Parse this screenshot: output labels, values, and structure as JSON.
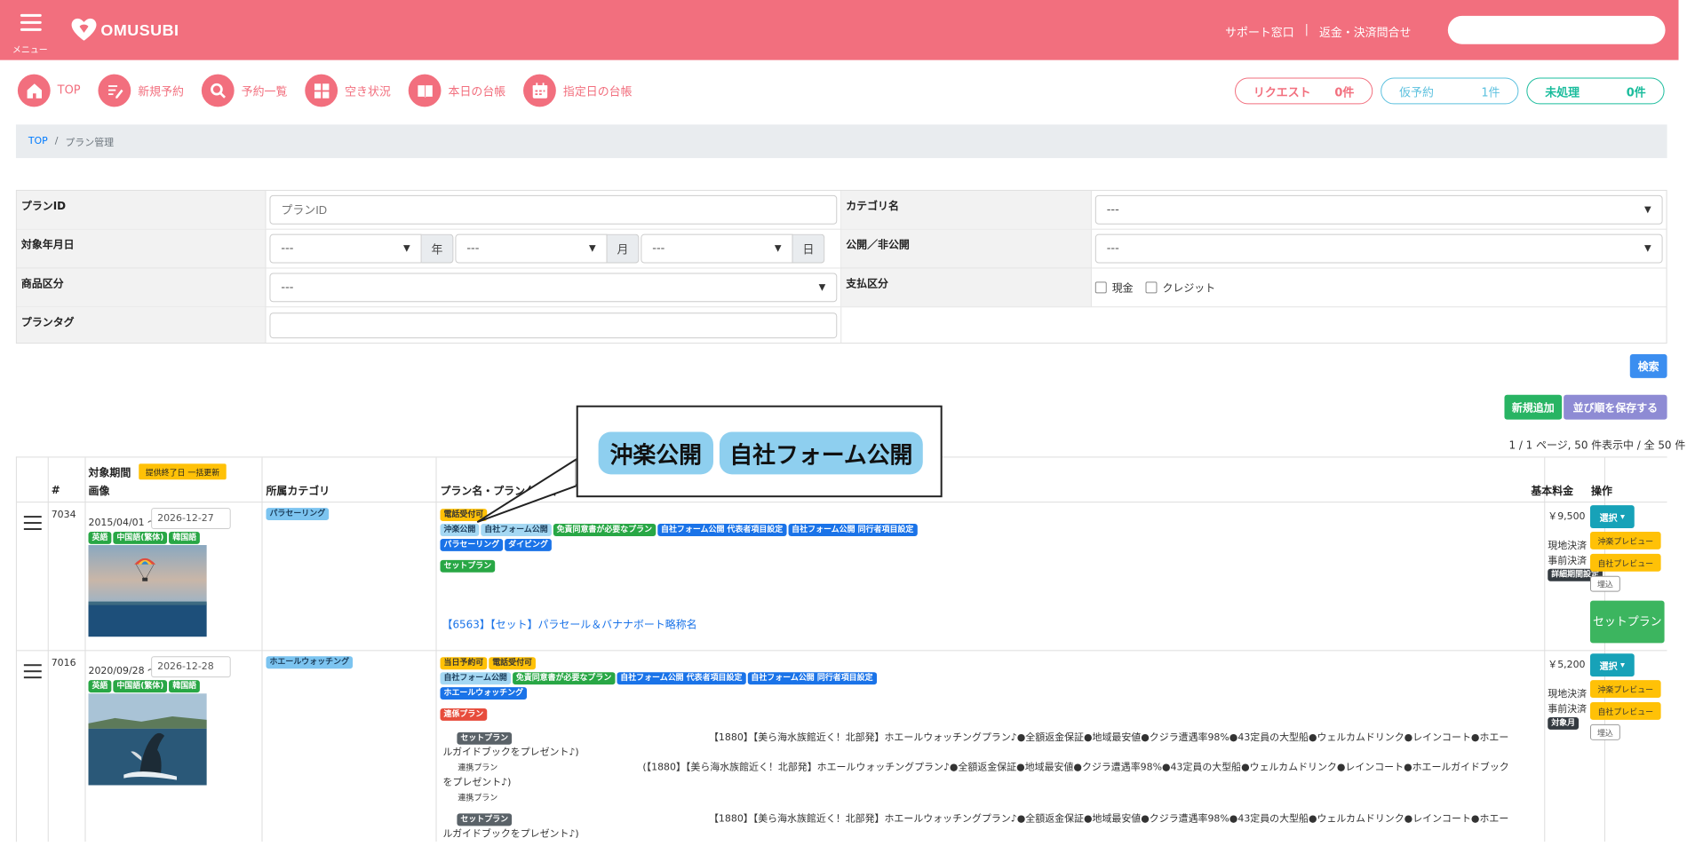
{
  "header": {
    "menu_label": "メニュー",
    "logo_text": "OMUSUBI",
    "support_link": "サポート窓口",
    "separator": "|",
    "refund_link": "返金・決済問合せ",
    "search_placeholder": ""
  },
  "quicknav": [
    {
      "label": "TOP",
      "icon": "home-icon"
    },
    {
      "label": "新規予約",
      "icon": "edit-icon"
    },
    {
      "label": "予約一覧",
      "icon": "search-icon"
    },
    {
      "label": "空き状況",
      "icon": "grid-icon"
    },
    {
      "label": "本日の台帳",
      "icon": "book-icon"
    },
    {
      "label": "指定日の台帳",
      "icon": "calendar-icon"
    }
  ],
  "status": {
    "request_label": "リクエスト",
    "request_count": "0件",
    "temp_label": "仮予約",
    "temp_count": "1件",
    "unprocessed_label": "未処理",
    "unprocessed_count": "0件"
  },
  "breadcrumb": {
    "top": "TOP",
    "sep": "/",
    "current": "プラン管理"
  },
  "form": {
    "plan_id_label": "プランID",
    "plan_id_placeholder": "プランID",
    "category_label": "カテゴリ名",
    "category_value": "---",
    "date_label": "対象年月日",
    "year_value": "---",
    "year_unit": "年",
    "month_value": "---",
    "month_unit": "月",
    "day_value": "---",
    "day_unit": "日",
    "public_label": "公開／非公開",
    "public_value": "---",
    "product_label": "商品区分",
    "product_value": "---",
    "payment_label": "支払区分",
    "cash_label": "現金",
    "credit_label": "クレジット",
    "tag_label": "プランタグ"
  },
  "buttons": {
    "search": "検索",
    "new": "新規追加",
    "save_order": "並び順を保存する"
  },
  "page_info": "1 / 1 ページ, 50 件表示中 / 全 50 件",
  "table": {
    "headers": {
      "num": "#",
      "period": "対象期間",
      "bulk_update": "提供終了日 一括更新",
      "image": "画像",
      "category": "所属カテゴリ",
      "plan": "プラン名・プランタグ名",
      "price": "基本料金",
      "ops": "操作"
    },
    "rows": [
      {
        "id": "7034",
        "period_start": "2015/04/01 〜",
        "period_end": "2026-12-27",
        "langs": [
          "英語",
          "中国語(繁体)",
          "韓国語"
        ],
        "category": "パラセーリング",
        "tags1": [
          "電話受付可"
        ],
        "tags2": [
          "沖楽公開",
          "自社フォーム公開",
          "免責同意書が必要なプラン",
          "自社フォーム公開 代表者項目設定",
          "自社フォーム公開 同行者項目設定"
        ],
        "tags3": [
          "パラセーリング",
          "ダイビング"
        ],
        "tags4": [
          "セットプラン"
        ],
        "plan_name": "【6563】【セット】パラセール＆バナナボート略称名",
        "price": "￥9,500",
        "pay1": "現地決済",
        "pay2": "事前決済",
        "pay_badge": "詳細期間設定",
        "op_select": "選択",
        "op_preview1": "沖楽プレビュー",
        "op_preview2": "自社プレビュー",
        "op_embed": "埋込",
        "op_set": "セットプラン"
      },
      {
        "id": "7016",
        "period_start": "2020/09/28 〜",
        "period_end": "2026-12-28",
        "langs": [
          "英語",
          "中国語(繁体)",
          "韓国語"
        ],
        "category": "ホエールウォッチング",
        "tags1": [
          "当日予約可",
          "電話受付可"
        ],
        "tags2": [
          "自社フォーム公開",
          "免責同意書が必要なプラン",
          "自社フォーム公開 代表者項目設定",
          "自社フォーム公開 同行者項目設定"
        ],
        "tags3": [
          "ホエールウォッチング"
        ],
        "tags4": [
          "連係プラン"
        ],
        "sub_badge1": "セットプラン",
        "sub_text1a": "【1880】【美ら海水族館近く！北部発】ホエールウォッチングプラン♪●全額返金保証●地域最安値●クジラ遭遇率98%●43定員の大型船●ウェルカムドリンク●レインコート●ホエー",
        "sub_text1b": "ルガイドブックをプレゼント♪)",
        "sub_badge2": "連携プラン",
        "sub_text2a": "(【1880】【美ら海水族館近く！北部発】ホエールウォッチングプラン♪●全額返金保証●地域最安値●クジラ遭遇率98%●43定員の大型船●ウェルカムドリンク●レインコート●ホエールガイドブック",
        "sub_text2b": "をプレゼント♪)",
        "sub_badge3": "連携プラン",
        "sub_badge4": "セットプラン",
        "sub_text4a": "【1880】【美ら海水族館近く！北部発】ホエールウォッチングプラン♪●全額返金保証●地域最安値●クジラ遭遇率98%●43定員の大型船●ウェルカムドリンク●レインコート●ホエー",
        "sub_text4b": "ルガイドブックをプレゼント♪)",
        "price": "￥5,200",
        "pay1": "現地決済",
        "pay2": "事前決済",
        "pay_badge": "対象月",
        "op_select": "選択",
        "op_preview1": "沖楽プレビュー",
        "op_preview2": "自社プレビュー",
        "op_embed": "埋込"
      }
    ]
  },
  "callout": {
    "tag1": "沖楽公開",
    "tag2": "自社フォーム公開"
  },
  "colors": {
    "brand": "#f26f7e",
    "accent_blue": "#3b8ef0",
    "green": "#28b463"
  }
}
